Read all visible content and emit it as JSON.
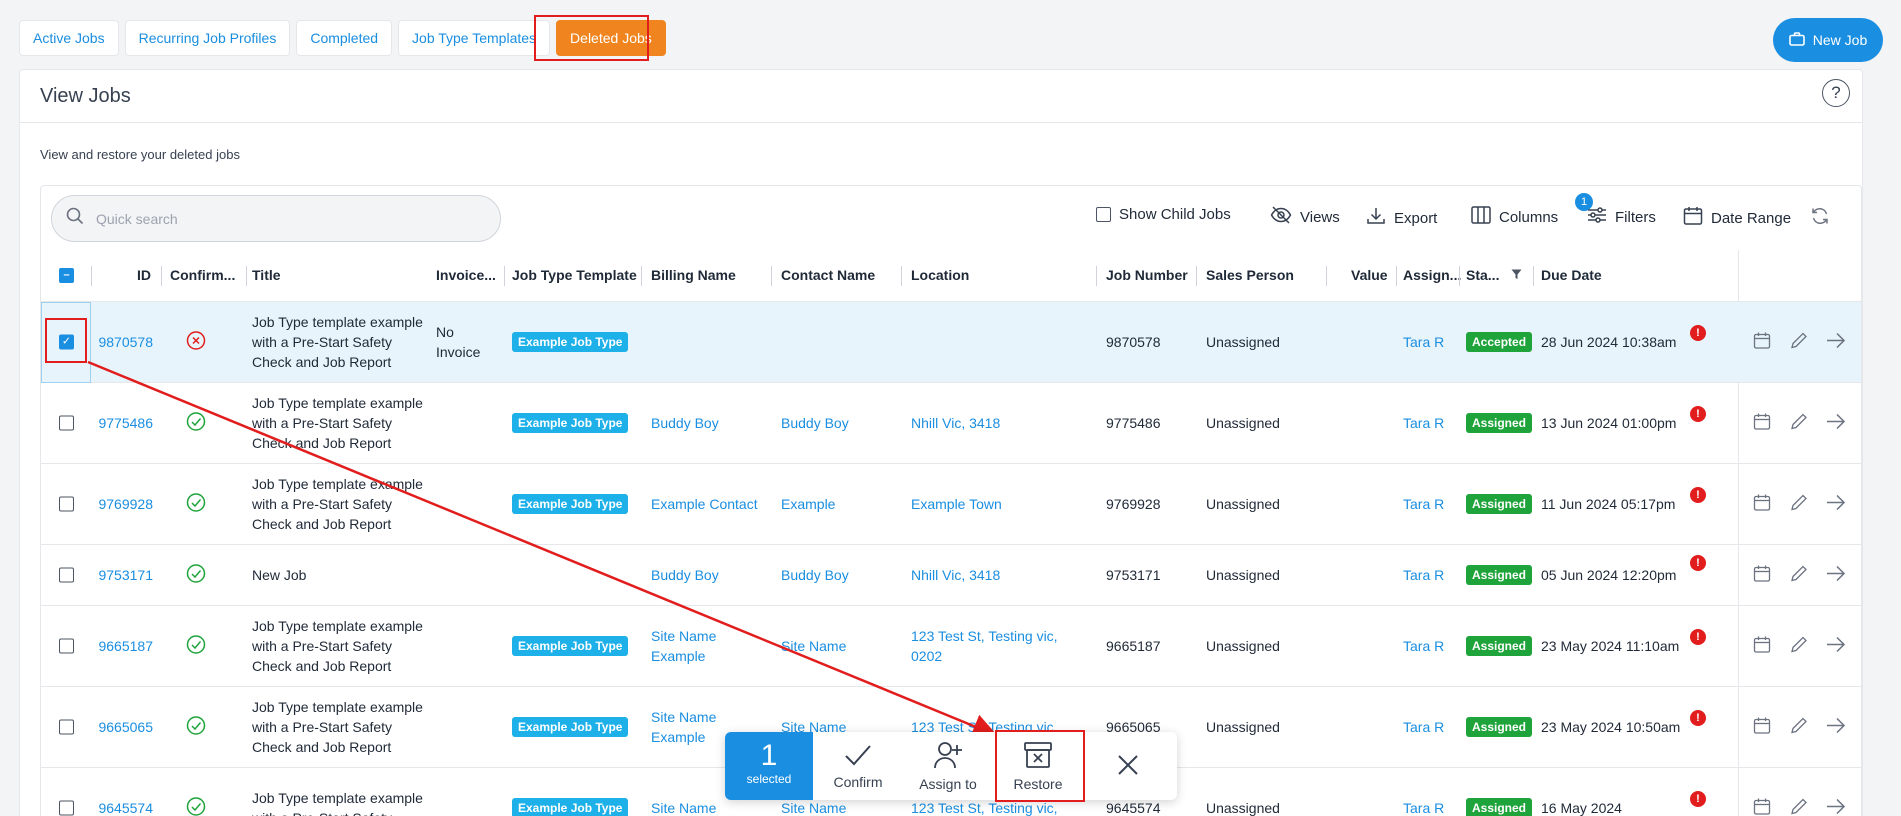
{
  "tabs": [
    "Active Jobs",
    "Recurring Job Profiles",
    "Completed",
    "Job Type Templates",
    "Deleted Jobs"
  ],
  "new_job_label": "New Job",
  "page_title": "View Jobs",
  "help_label": "?",
  "subtitle": "View and restore your deleted jobs",
  "search": {
    "placeholder": "Quick search"
  },
  "toolbar": {
    "show_child_jobs": "Show Child Jobs",
    "views": "Views",
    "export": "Export",
    "columns": "Columns",
    "filters": "Filters",
    "filters_count": "1",
    "date_range": "Date Range"
  },
  "columns": [
    "ID",
    "Confirm...",
    "Title",
    "Invoice...",
    "Job Type Template",
    "Billing Name",
    "Contact Name",
    "Location",
    "Job Number",
    "Sales Person",
    "Value",
    "Assign...",
    "Sta...",
    "Due Date"
  ],
  "rows": [
    {
      "id": "9870578",
      "confirmed": false,
      "title": "Job Type template example with a Pre-Start Safety Check and Job Report",
      "invoice": "No Invoice",
      "template": "Example Job Type",
      "billing": "",
      "contact": "",
      "location": "",
      "job_number": "9870578",
      "sales": "Unassigned",
      "assigned": "Tara R",
      "status": "Accepted",
      "due": "28 Jun 2024 10:38am",
      "selected": true
    },
    {
      "id": "9775486",
      "confirmed": true,
      "title": "Job Type template example with a Pre-Start Safety Check and Job Report",
      "invoice": "",
      "template": "Example Job Type",
      "billing": "Buddy Boy",
      "contact": "Buddy Boy",
      "location": "Nhill Vic, 3418",
      "job_number": "9775486",
      "sales": "Unassigned",
      "assigned": "Tara R",
      "status": "Assigned",
      "due": "13 Jun 2024 01:00pm",
      "selected": false
    },
    {
      "id": "9769928",
      "confirmed": true,
      "title": "Job Type template example with a Pre-Start Safety Check and Job Report",
      "invoice": "",
      "template": "Example Job Type",
      "billing": "Example Contact",
      "contact": "Example",
      "location": "Example Town",
      "job_number": "9769928",
      "sales": "Unassigned",
      "assigned": "Tara R",
      "status": "Assigned",
      "due": "11 Jun 2024 05:17pm",
      "selected": false
    },
    {
      "id": "9753171",
      "confirmed": true,
      "title": "New Job",
      "invoice": "",
      "template": "",
      "billing": "Buddy Boy",
      "contact": "Buddy Boy",
      "location": "Nhill Vic, 3418",
      "job_number": "9753171",
      "sales": "Unassigned",
      "assigned": "Tara R",
      "status": "Assigned",
      "due": "05 Jun 2024 12:20pm",
      "selected": false
    },
    {
      "id": "9665187",
      "confirmed": true,
      "title": "Job Type template example with a Pre-Start Safety Check and Job Report",
      "invoice": "",
      "template": "Example Job Type",
      "billing": "Site Name Example",
      "contact": "Site Name",
      "location": "123 Test St, Testing vic, 0202",
      "job_number": "9665187",
      "sales": "Unassigned",
      "assigned": "Tara R",
      "status": "Assigned",
      "due": "23 May 2024 11:10am",
      "selected": false
    },
    {
      "id": "9665065",
      "confirmed": true,
      "title": "Job Type template example with a Pre-Start Safety Check and Job Report",
      "invoice": "",
      "template": "Example Job Type",
      "billing": "Site Name Example",
      "contact": "Site Name",
      "location": "123 Test St, Testing vic,",
      "job_number": "9665065",
      "sales": "Unassigned",
      "assigned": "Tara R",
      "status": "Assigned",
      "due": "23 May 2024 10:50am",
      "selected": false
    },
    {
      "id": "9645574",
      "confirmed": true,
      "title": "Job Type template example with a Pre-Start Safety",
      "invoice": "",
      "template": "Example Job Type",
      "billing": "Site Name",
      "contact": "Site Name",
      "location": "123 Test St, Testing vic,",
      "job_number": "9645574",
      "sales": "Unassigned",
      "assigned": "Tara R",
      "status": "Assigned",
      "due": "16 May 2024",
      "selected": false
    }
  ],
  "bulk": {
    "count": "1",
    "count_label": "selected",
    "confirm": "Confirm",
    "assign": "Assign to",
    "restore": "Restore"
  },
  "colors": {
    "accent": "#1a8ee0",
    "active_tab": "#f0851f",
    "highlight": "#e11d1d",
    "status_green": "#1fa33b",
    "job_type_pill": "#1eb0e8"
  }
}
